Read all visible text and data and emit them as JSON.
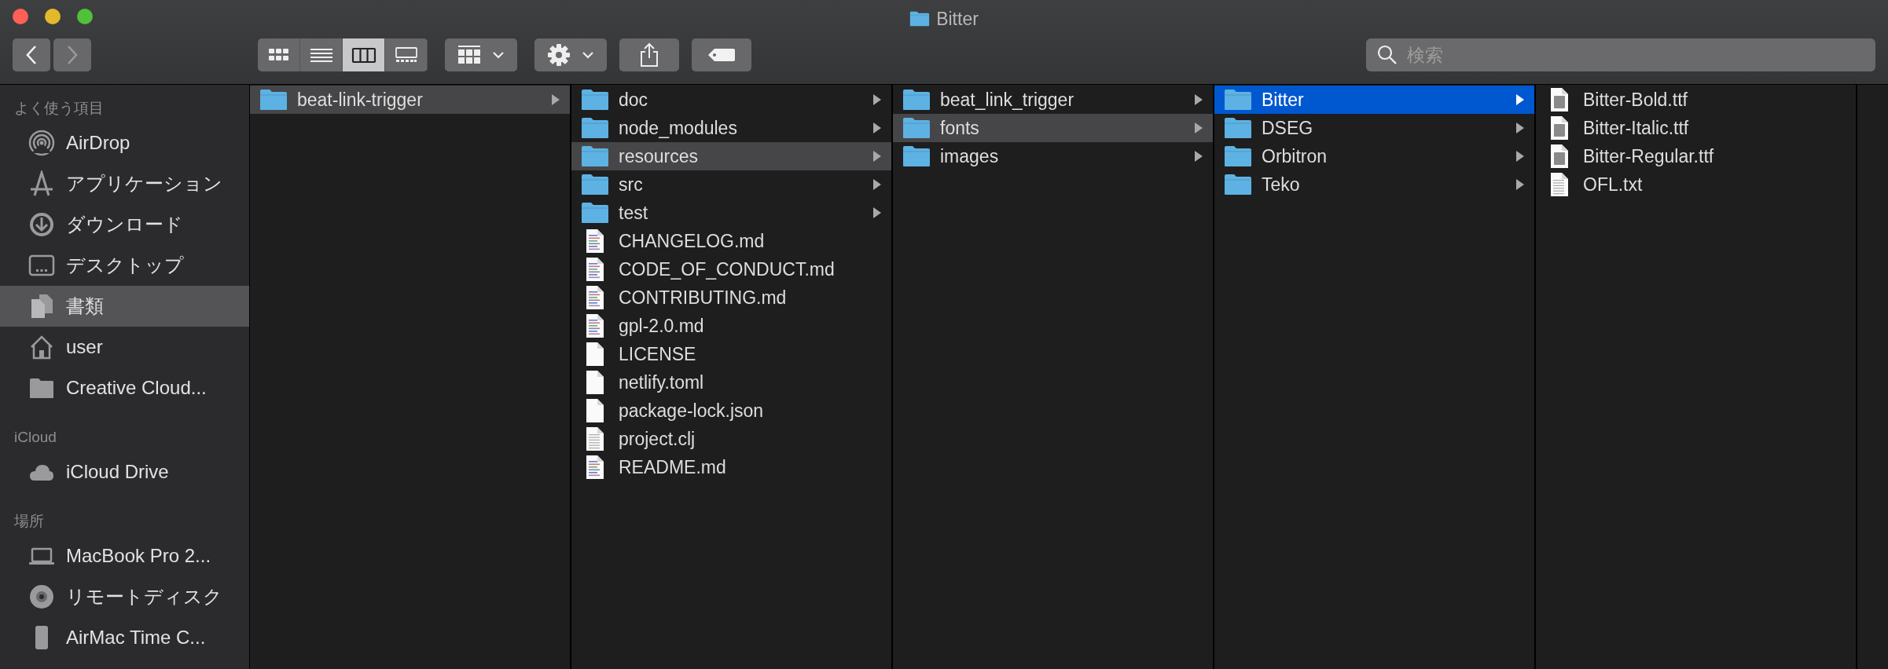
{
  "window": {
    "title": "Bitter"
  },
  "toolbar": {
    "back": {
      "disabled": false
    },
    "forward": {
      "disabled": true
    },
    "view_modes": [
      {
        "kind": "icons",
        "selected": false
      },
      {
        "kind": "list",
        "selected": false
      },
      {
        "kind": "columns",
        "selected": true
      },
      {
        "kind": "gallery",
        "selected": false
      }
    ],
    "search": {
      "placeholder": "検索"
    }
  },
  "sidebar": {
    "sections": [
      {
        "heading": "よく使う項目",
        "items": [
          {
            "label": "AirDrop",
            "kind": "airdrop",
            "selected": false
          },
          {
            "label": "アプリケーション",
            "kind": "applications",
            "selected": false
          },
          {
            "label": "ダウンロード",
            "kind": "downloads",
            "selected": false
          },
          {
            "label": "デスクトップ",
            "kind": "desktop",
            "selected": false
          },
          {
            "label": "書類",
            "kind": "documents",
            "selected": true
          },
          {
            "label": "user",
            "kind": "home",
            "selected": false
          },
          {
            "label": "Creative Cloud...",
            "kind": "folder",
            "selected": false
          }
        ]
      },
      {
        "heading": "iCloud",
        "items": [
          {
            "label": "iCloud Drive",
            "kind": "cloud",
            "selected": false
          }
        ]
      },
      {
        "heading": "場所",
        "items": [
          {
            "label": "MacBook Pro 2...",
            "kind": "laptop",
            "selected": false
          },
          {
            "label": "リモートディスク",
            "kind": "disc",
            "selected": false
          },
          {
            "label": "AirMac Time C...",
            "kind": "device",
            "selected": false
          }
        ]
      }
    ]
  },
  "columns": [
    {
      "items": [
        {
          "name": "beat-link-trigger",
          "kind": "folder",
          "selected": true
        }
      ]
    },
    {
      "items": [
        {
          "name": "doc",
          "kind": "folder",
          "selected": false
        },
        {
          "name": "node_modules",
          "kind": "folder",
          "selected": false
        },
        {
          "name": "resources",
          "kind": "folder",
          "selected": true
        },
        {
          "name": "src",
          "kind": "folder",
          "selected": false
        },
        {
          "name": "test",
          "kind": "folder",
          "selected": false
        },
        {
          "name": "CHANGELOG.md",
          "kind": "text",
          "selected": false
        },
        {
          "name": "CODE_OF_CONDUCT.md",
          "kind": "text",
          "selected": false
        },
        {
          "name": "CONTRIBUTING.md",
          "kind": "text",
          "selected": false
        },
        {
          "name": "gpl-2.0.md",
          "kind": "text",
          "selected": false
        },
        {
          "name": "LICENSE",
          "kind": "blank",
          "selected": false
        },
        {
          "name": "netlify.toml",
          "kind": "blank",
          "selected": false
        },
        {
          "name": "package-lock.json",
          "kind": "blank",
          "selected": false
        },
        {
          "name": "project.clj",
          "kind": "plain",
          "selected": false
        },
        {
          "name": "README.md",
          "kind": "text",
          "selected": false
        }
      ]
    },
    {
      "items": [
        {
          "name": "beat_link_trigger",
          "kind": "folder",
          "selected": false
        },
        {
          "name": "fonts",
          "kind": "folder",
          "selected": true
        },
        {
          "name": "images",
          "kind": "folder",
          "selected": false
        }
      ]
    },
    {
      "items": [
        {
          "name": "Bitter",
          "kind": "folder",
          "selected": true
        },
        {
          "name": "DSEG",
          "kind": "folder",
          "selected": false
        },
        {
          "name": "Orbitron",
          "kind": "folder",
          "selected": false
        },
        {
          "name": "Teko",
          "kind": "folder",
          "selected": false
        }
      ]
    },
    {
      "items": [
        {
          "name": "Bitter-Bold.ttf",
          "kind": "font",
          "selected": false
        },
        {
          "name": "Bitter-Italic.ttf",
          "kind": "font",
          "selected": false
        },
        {
          "name": "Bitter-Regular.ttf",
          "kind": "font",
          "selected": false
        },
        {
          "name": "OFL.txt",
          "kind": "plain",
          "selected": false
        }
      ]
    }
  ]
}
